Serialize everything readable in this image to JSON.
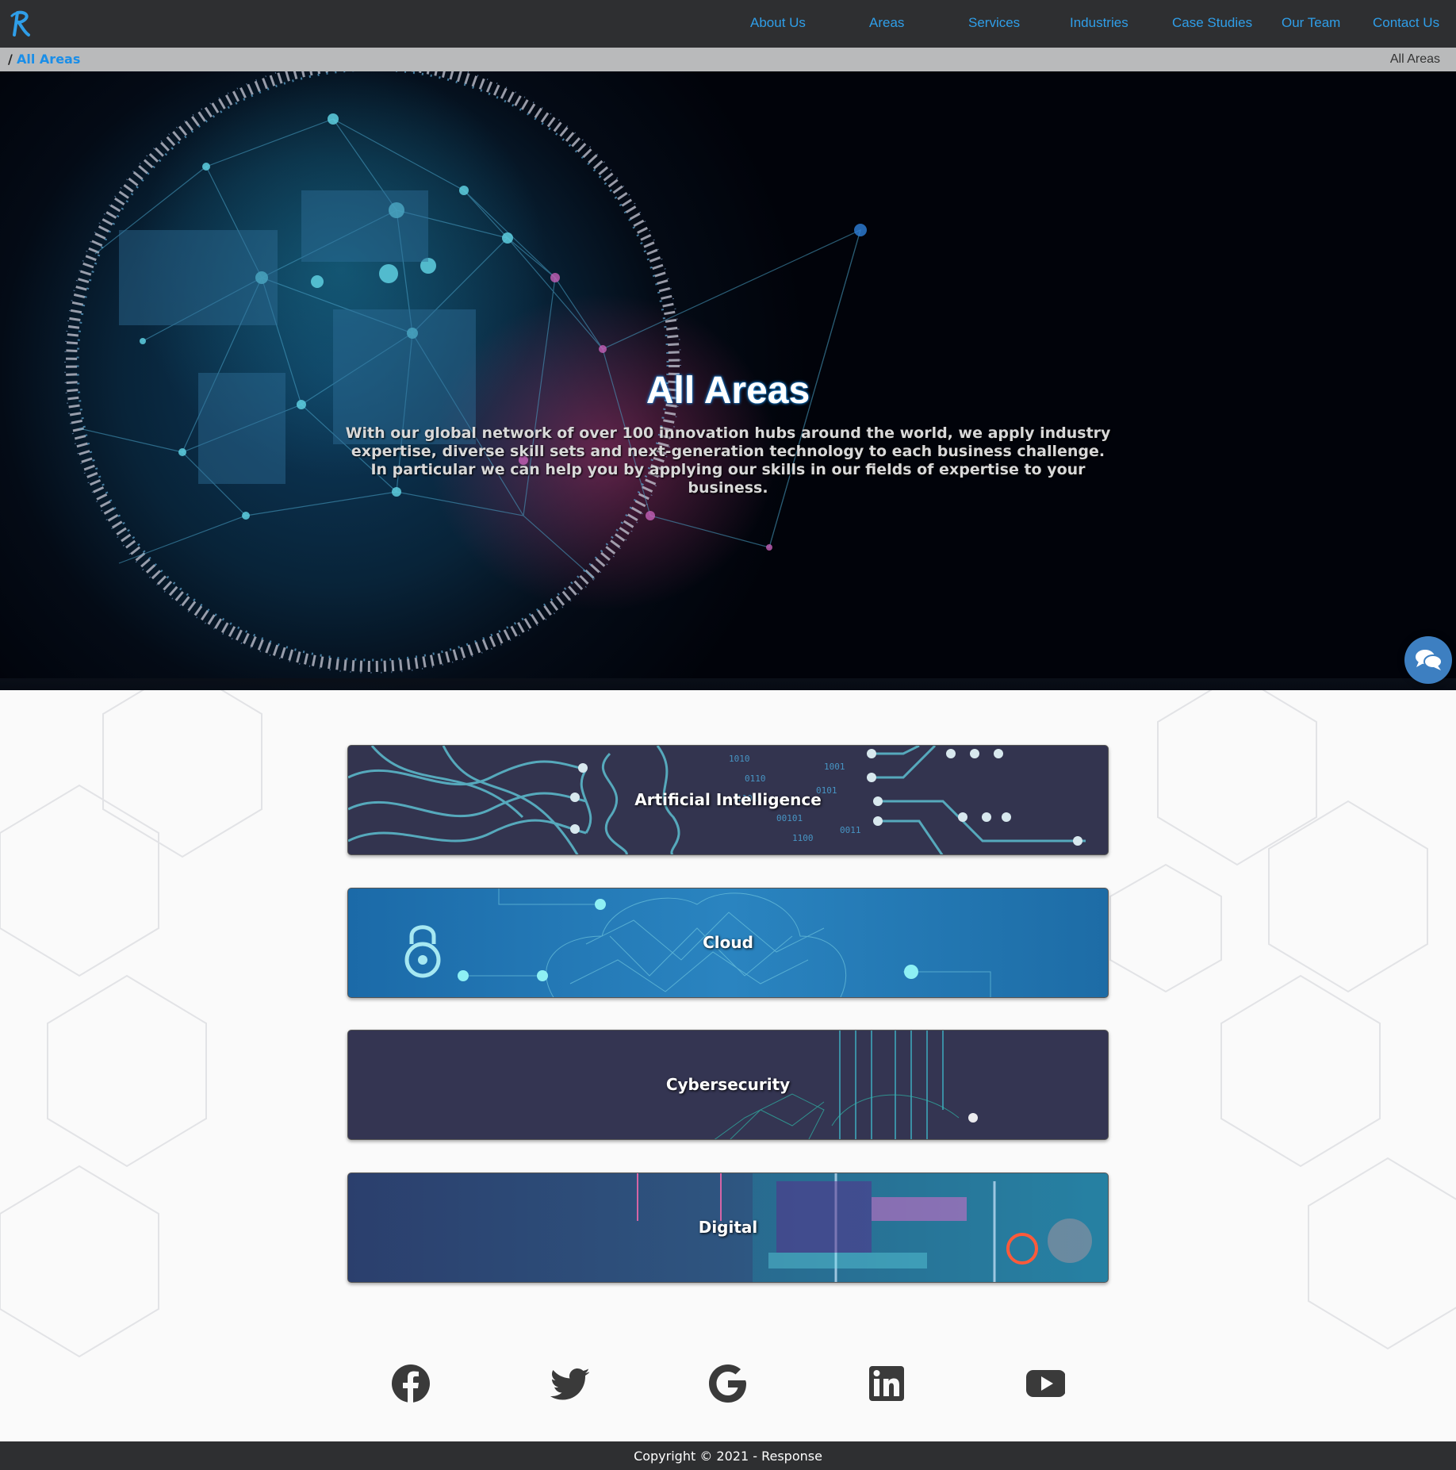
{
  "nav": {
    "items": [
      {
        "label": "About Us"
      },
      {
        "label": "Areas"
      },
      {
        "label": "Services"
      },
      {
        "label": "Industries"
      },
      {
        "label": "Case Studies"
      },
      {
        "label": "Our Team"
      },
      {
        "label": "Contact Us"
      }
    ],
    "logo_icon": "script-r-logo-icon",
    "accent_color": "#2f9ee8"
  },
  "breadcrumb": {
    "separator": "/",
    "current": "All Areas",
    "right_label": "All Areas"
  },
  "hero": {
    "title": "All Areas",
    "description": "With our global network of over 100 innovation hubs around the world, we apply industry expertise, diverse skill sets and next-generation technology to each business challenge. In particular we can help you by applying our skills in our fields of expertise to your business."
  },
  "areas": [
    {
      "label": "Artificial Intelligence"
    },
    {
      "label": "Cloud"
    },
    {
      "label": "Cybersecurity"
    },
    {
      "label": "Digital"
    }
  ],
  "social": [
    "facebook-icon",
    "twitter-icon",
    "google-icon",
    "linkedin-icon",
    "youtube-icon"
  ],
  "chat_icon": "chat-bubbles-icon",
  "footer": {
    "copyright": "Copyright © 2021 - Response"
  }
}
